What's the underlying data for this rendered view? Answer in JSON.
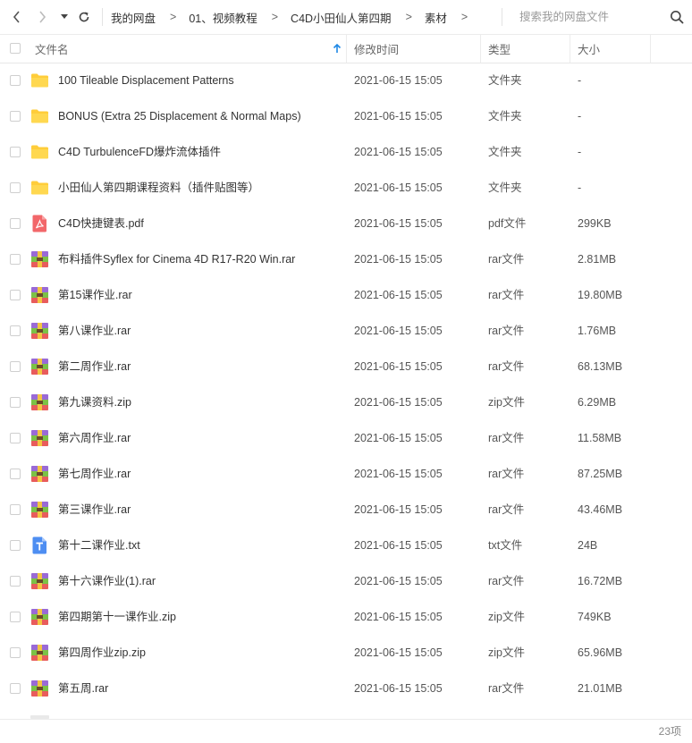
{
  "toolbar": {
    "back_icon": "chevron-left-icon",
    "forward_icon": "chevron-right-icon",
    "history_icon": "caret-down-icon",
    "refresh_icon": "refresh-icon"
  },
  "breadcrumb": [
    "我的网盘",
    "01、视频教程",
    "C4D小田仙人第四期",
    "素材"
  ],
  "breadcrumb_separator": ">",
  "search": {
    "placeholder": "搜索我的网盘文件",
    "value": "",
    "icon": "search-icon"
  },
  "columns": {
    "name": "文件名",
    "modified": "修改时间",
    "type": "类型",
    "size": "大小",
    "sort_icon": "arrow-up-icon"
  },
  "colors": {
    "folder": "#FFCD3A",
    "pdf": "#F2676A",
    "txt": "#4E8EF2",
    "archive_green": "#7CC246",
    "archive_purple": "#9A6AD6",
    "accent_blue": "#1E88E5"
  },
  "files": [
    {
      "name": "100 Tileable Displacement Patterns",
      "modified": "2021-06-15 15:05",
      "type": "文件夹",
      "size": "-",
      "icon": "folder-icon"
    },
    {
      "name": "BONUS (Extra 25 Displacement & Normal Maps)",
      "modified": "2021-06-15 15:05",
      "type": "文件夹",
      "size": "-",
      "icon": "folder-icon"
    },
    {
      "name": "C4D TurbulenceFD爆炸流体插件",
      "modified": "2021-06-15 15:05",
      "type": "文件夹",
      "size": "-",
      "icon": "folder-icon"
    },
    {
      "name": "小田仙人第四期课程资料（插件贴图等）",
      "modified": "2021-06-15 15:05",
      "type": "文件夹",
      "size": "-",
      "icon": "folder-icon"
    },
    {
      "name": "C4D快捷键表.pdf",
      "modified": "2021-06-15 15:05",
      "type": "pdf文件",
      "size": "299KB",
      "icon": "pdf-file-icon"
    },
    {
      "name": "布料插件Syflex for Cinema 4D R17-R20 Win.rar",
      "modified": "2021-06-15 15:05",
      "type": "rar文件",
      "size": "2.81MB",
      "icon": "archive-file-icon"
    },
    {
      "name": "第15课作业.rar",
      "modified": "2021-06-15 15:05",
      "type": "rar文件",
      "size": "19.80MB",
      "icon": "archive-file-icon"
    },
    {
      "name": "第八课作业.rar",
      "modified": "2021-06-15 15:05",
      "type": "rar文件",
      "size": "1.76MB",
      "icon": "archive-file-icon"
    },
    {
      "name": "第二周作业.rar",
      "modified": "2021-06-15 15:05",
      "type": "rar文件",
      "size": "68.13MB",
      "icon": "archive-file-icon"
    },
    {
      "name": "第九课资料.zip",
      "modified": "2021-06-15 15:05",
      "type": "zip文件",
      "size": "6.29MB",
      "icon": "archive-file-icon"
    },
    {
      "name": "第六周作业.rar",
      "modified": "2021-06-15 15:05",
      "type": "rar文件",
      "size": "11.58MB",
      "icon": "archive-file-icon"
    },
    {
      "name": "第七周作业.rar",
      "modified": "2021-06-15 15:05",
      "type": "rar文件",
      "size": "87.25MB",
      "icon": "archive-file-icon"
    },
    {
      "name": "第三课作业.rar",
      "modified": "2021-06-15 15:05",
      "type": "rar文件",
      "size": "43.46MB",
      "icon": "archive-file-icon"
    },
    {
      "name": "第十二课作业.txt",
      "modified": "2021-06-15 15:05",
      "type": "txt文件",
      "size": "24B",
      "icon": "text-file-icon"
    },
    {
      "name": "第十六课作业(1).rar",
      "modified": "2021-06-15 15:05",
      "type": "rar文件",
      "size": "16.72MB",
      "icon": "archive-file-icon"
    },
    {
      "name": "第四期第十一课作业.zip",
      "modified": "2021-06-15 15:05",
      "type": "zip文件",
      "size": "749KB",
      "icon": "archive-file-icon"
    },
    {
      "name": "第四周作业zip.zip",
      "modified": "2021-06-15 15:05",
      "type": "zip文件",
      "size": "65.96MB",
      "icon": "archive-file-icon"
    },
    {
      "name": "第五周.rar",
      "modified": "2021-06-15 15:05",
      "type": "rar文件",
      "size": "21.01MB",
      "icon": "archive-file-icon"
    }
  ],
  "status": {
    "item_count": "23项"
  }
}
